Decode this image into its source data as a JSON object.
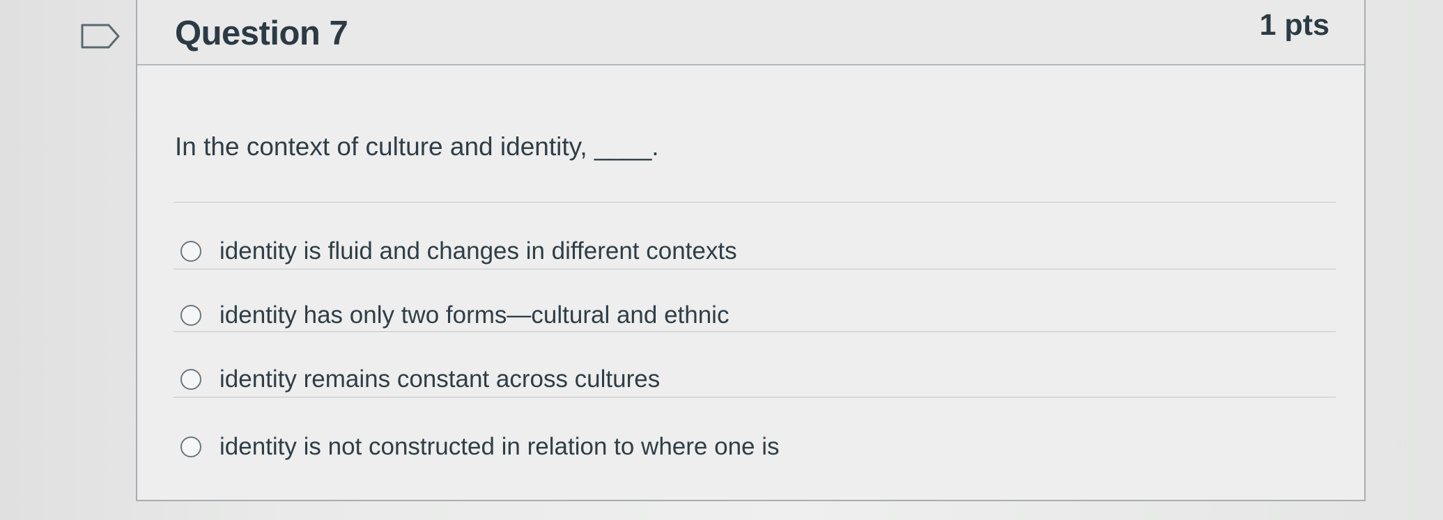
{
  "question": {
    "title": "Question 7",
    "points": "1 pts",
    "text": "In the context of culture and identity, ____.",
    "flag_icon": "flag-outline-icon"
  },
  "answers": [
    {
      "label": "identity is fluid and changes in different contexts",
      "selected": false
    },
    {
      "label": "identity has only two forms—cultural and ethnic",
      "selected": false
    },
    {
      "label": "identity remains constant across cultures",
      "selected": false
    },
    {
      "label": "identity is not constructed in relation to where one is",
      "selected": false
    }
  ],
  "colors": {
    "text": "#2d3b45",
    "border": "#a9adb1",
    "background": "#e6e7e6"
  }
}
